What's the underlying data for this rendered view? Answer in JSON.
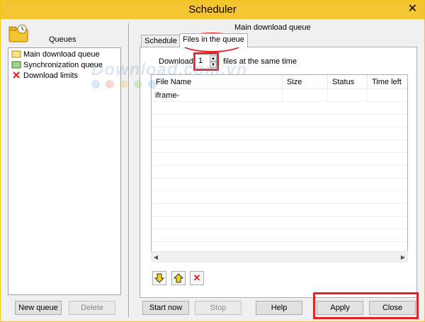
{
  "window": {
    "title": "Scheduler",
    "close_glyph": "✕"
  },
  "left": {
    "queues_label": "Queues",
    "items": [
      {
        "label": "Main download queue",
        "icon": "queue-folder-icon"
      },
      {
        "label": "Synchronization queue",
        "icon": "sync-queue-icon"
      },
      {
        "label": "Download limits",
        "icon": "download-limits-icon"
      }
    ],
    "new_queue": "New queue",
    "delete": "Delete"
  },
  "right": {
    "queue_title": "Main download queue",
    "tabs": [
      {
        "label": "Schedule",
        "active": false
      },
      {
        "label": "Files in the queue",
        "active": true
      }
    ],
    "download_label": "Download",
    "download_count": "1",
    "same_time_label": "files at the same time",
    "table": {
      "columns": [
        "File Name",
        "Size",
        "Status",
        "Time left"
      ],
      "rows": [
        {
          "file_name": "iframe-",
          "size": "",
          "status": "",
          "time_left": ""
        }
      ]
    },
    "tool_icons": [
      "move-down-icon",
      "move-up-icon",
      "delete-file-icon"
    ]
  },
  "footer": {
    "start_now": "Start now",
    "stop": "Stop",
    "help": "Help",
    "apply": "Apply",
    "close": "Close"
  },
  "watermark": "Download.com.vn",
  "colors": {
    "titlebar": "#f5c431",
    "highlight": "#e0242a",
    "delete_red": "#d22222"
  }
}
